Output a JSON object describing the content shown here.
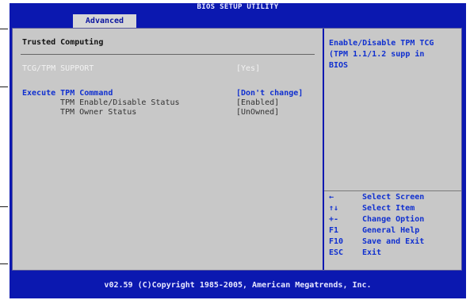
{
  "header": {
    "title": "BIOS SETUP UTILITY",
    "active_tab": "Advanced"
  },
  "section": {
    "title": "Trusted Computing"
  },
  "settings": [
    {
      "label": "TCG/TPM SUPPORT",
      "value": "[Yes]",
      "state": "faded",
      "indent": 0
    },
    {
      "label": "Execute TPM Command",
      "value": "[Don't change]",
      "state": "highlight",
      "indent": 0
    },
    {
      "label": "TPM Enable/Disable Status",
      "value": "[Enabled]",
      "state": "normal",
      "indent": 1
    },
    {
      "label": "TPM Owner Status",
      "value": "[UnOwned]",
      "state": "normal",
      "indent": 1
    }
  ],
  "help": {
    "description": "Enable/Disable TPM TCG (TPM 1.1/1.2 supp in BIOS"
  },
  "keys": [
    {
      "key": "←",
      "desc": "Select Screen"
    },
    {
      "key": "↑↓",
      "desc": "Select Item"
    },
    {
      "key": "+-",
      "desc": "Change Option"
    },
    {
      "key": "F1",
      "desc": "General Help"
    },
    {
      "key": "F10",
      "desc": "Save and Exit"
    },
    {
      "key": "ESC",
      "desc": "Exit"
    }
  ],
  "footer": {
    "copyright": "v02.59 (C)Copyright 1985-2005, American Megatrends, Inc."
  },
  "colors": {
    "screen_bg": "#0b18b0",
    "panel_bg": "#c8c8c8",
    "highlight_text": "#1030d0"
  }
}
